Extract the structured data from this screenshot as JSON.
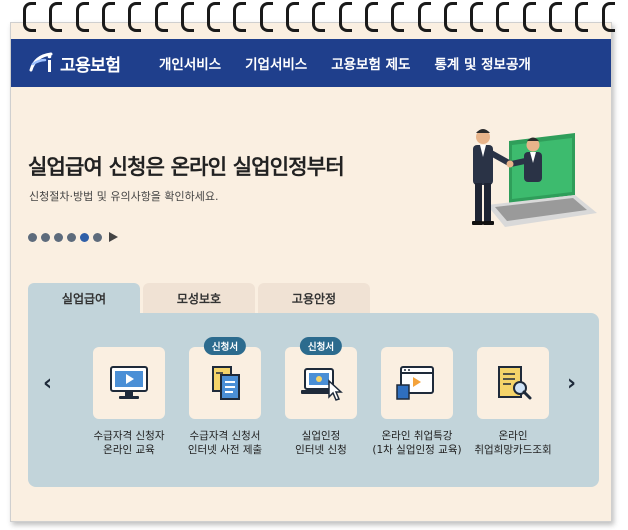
{
  "header": {
    "logo_text": "고용보험",
    "nav": [
      "개인서비스",
      "기업서비스",
      "고용보험 제도",
      "통계 및 정보공개"
    ]
  },
  "hero": {
    "title": "실업급여 신청은 온라인 실업인정부터",
    "subtitle": "신청절차·방법 및 유의사항을 확인하세요."
  },
  "slider": {
    "dot_count": 6,
    "active_index": 4
  },
  "tabs": [
    "실업급여",
    "모성보호",
    "고용안정"
  ],
  "cards": [
    {
      "icon": "monitor-play-icon",
      "badge": "",
      "line1": "수급자격 신청자",
      "line2": "온라인 교육"
    },
    {
      "icon": "document-form-icon",
      "badge": "신청서",
      "line1": "수급자격 신청서",
      "line2": "인터넷 사전 제출"
    },
    {
      "icon": "laptop-click-icon",
      "badge": "신청서",
      "line1": "실업인정",
      "line2": "인터넷 신청"
    },
    {
      "icon": "video-window-icon",
      "badge": "",
      "line1": "온라인 취업특강",
      "line2": "(1차 실업인정 교육)"
    },
    {
      "icon": "document-search-icon",
      "badge": "",
      "line1": "온라인",
      "line2": "취업희망카드조회"
    }
  ],
  "colors": {
    "header": "#1f3f8c",
    "panel": "#c2d4da",
    "page": "#faefe1",
    "badge": "#2c6b8e"
  }
}
